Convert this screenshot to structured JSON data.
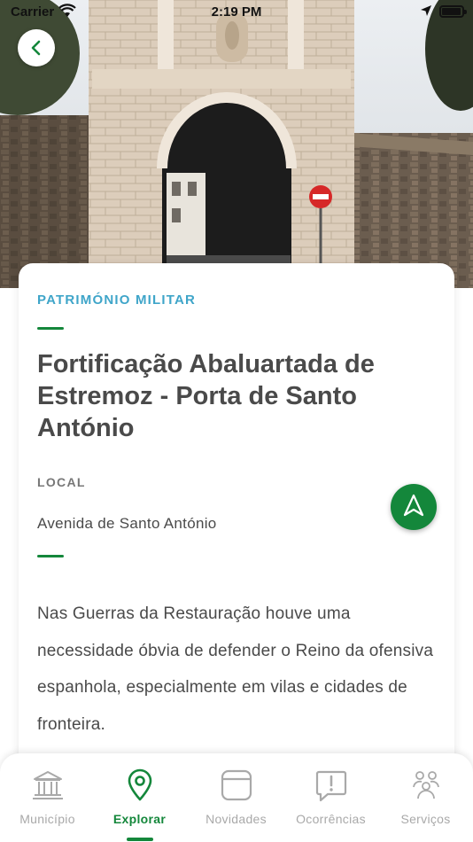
{
  "status_bar": {
    "carrier": "Carrier",
    "time": "2:19 PM",
    "wifi_icon": "wifi-icon",
    "location_icon": "location-arrow-icon",
    "battery_icon": "battery-icon"
  },
  "header": {
    "back_icon": "chevron-left-icon",
    "photo_subject": "Porta de Santo António gate"
  },
  "detail": {
    "category": "PATRIMÓNIO MILITAR",
    "title": "Fortificação Abaluartada de Estremoz - Porta de Santo António",
    "local_label": "LOCAL",
    "address": "Avenida de Santo António",
    "navigate_icon": "navigation-arrow-icon",
    "description": "Nas Guerras da Restauração houve uma necessidade óbvia de defender o Reino da ofensiva espanhola, especialmente em vilas e cidades de fronteira."
  },
  "tabbar": {
    "active_tab": "Explorar",
    "tabs": [
      {
        "label": "Município",
        "icon": "building-columns-icon"
      },
      {
        "label": "Explorar",
        "icon": "map-pin-icon"
      },
      {
        "label": "Novidades",
        "icon": "news-card-icon"
      },
      {
        "label": "Ocorrências",
        "icon": "alert-message-icon"
      },
      {
        "label": "Serviços",
        "icon": "people-group-icon"
      }
    ]
  },
  "colors": {
    "accent_green": "#14873b",
    "category_blue": "#3fa5c9",
    "text_dark": "#4a4a4a",
    "text_muted": "#777777",
    "tab_inactive": "#a9a9a9"
  }
}
